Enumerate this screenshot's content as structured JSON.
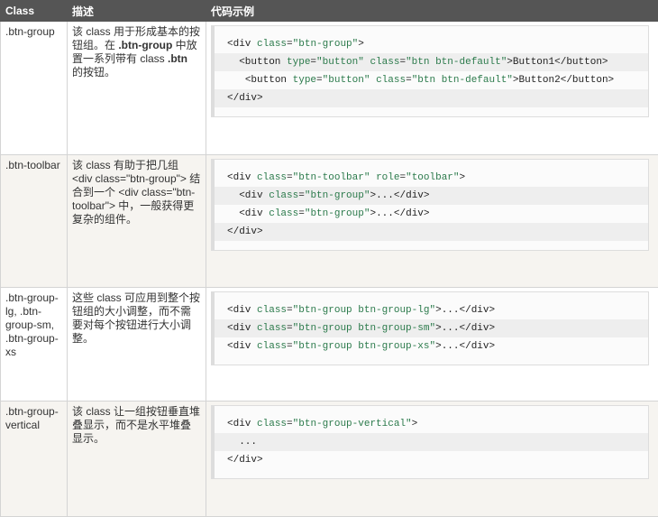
{
  "headers": {
    "class": "Class",
    "desc": "描述",
    "code": "代码示例"
  },
  "rows": [
    {
      "class": ".btn-group",
      "desc": [
        {
          "t": "该 class 用于形成基本的按钮组。在 "
        },
        {
          "t": ".btn-group",
          "b": true
        },
        {
          "t": " 中放置一系列带有 class "
        },
        {
          "t": ".btn",
          "b": true
        },
        {
          "t": " 的按钮。"
        }
      ],
      "code": [
        [
          {
            "k": "<div "
          },
          {
            "a": "class"
          },
          {
            "k": "="
          },
          {
            "s": "\"btn-group\""
          },
          {
            "k": ">"
          }
        ],
        [
          {
            "t": "  "
          },
          {
            "k": "<button "
          },
          {
            "a": "type"
          },
          {
            "k": "="
          },
          {
            "s": "\"button\""
          },
          {
            "k": " "
          },
          {
            "a": "class"
          },
          {
            "k": "="
          },
          {
            "s": "\"btn btn-default\""
          },
          {
            "k": ">"
          },
          {
            "t": "Button1"
          },
          {
            "k": "</button>"
          }
        ],
        [
          {
            "t": "   "
          },
          {
            "k": "<button "
          },
          {
            "a": "type"
          },
          {
            "k": "="
          },
          {
            "s": "\"button\""
          },
          {
            "k": " "
          },
          {
            "a": "class"
          },
          {
            "k": "="
          },
          {
            "s": "\"btn btn-default\""
          },
          {
            "k": ">"
          },
          {
            "t": "Button2"
          },
          {
            "k": "</button>"
          }
        ],
        [
          {
            "k": "</div>"
          }
        ]
      ]
    },
    {
      "class": ".btn-toolbar",
      "desc": [
        {
          "t": "该 class 有助于把几组 <div class=\"btn-group\"> 结合到一个 <div class=\"btn-toolbar\"> 中，一般获得更复杂的组件。"
        }
      ],
      "code": [
        [
          {
            "k": "<div "
          },
          {
            "a": "class"
          },
          {
            "k": "="
          },
          {
            "s": "\"btn-toolbar\""
          },
          {
            "k": " "
          },
          {
            "a": "role"
          },
          {
            "k": "="
          },
          {
            "s": "\"toolbar\""
          },
          {
            "k": ">"
          }
        ],
        [
          {
            "t": "  "
          },
          {
            "k": "<div "
          },
          {
            "a": "class"
          },
          {
            "k": "="
          },
          {
            "s": "\"btn-group\""
          },
          {
            "k": ">"
          },
          {
            "t": "..."
          },
          {
            "k": "</div>"
          }
        ],
        [
          {
            "t": "  "
          },
          {
            "k": "<div "
          },
          {
            "a": "class"
          },
          {
            "k": "="
          },
          {
            "s": "\"btn-group\""
          },
          {
            "k": ">"
          },
          {
            "t": "..."
          },
          {
            "k": "</div>"
          }
        ],
        [
          {
            "k": "</div>"
          }
        ]
      ]
    },
    {
      "class": ".btn-group-lg, .btn-group-sm, .btn-group-xs",
      "desc": [
        {
          "t": "这些 class 可应用到整个按钮组的大小调整，而不需要对每个按钮进行大小调整。"
        }
      ],
      "code": [
        [
          {
            "k": "<div "
          },
          {
            "a": "class"
          },
          {
            "k": "="
          },
          {
            "s": "\"btn-group btn-group-lg\""
          },
          {
            "k": ">"
          },
          {
            "t": "..."
          },
          {
            "k": "</div>"
          }
        ],
        [
          {
            "k": "<div "
          },
          {
            "a": "class"
          },
          {
            "k": "="
          },
          {
            "s": "\"btn-group btn-group-sm\""
          },
          {
            "k": ">"
          },
          {
            "t": "..."
          },
          {
            "k": "</div>"
          }
        ],
        [
          {
            "k": "<div "
          },
          {
            "a": "class"
          },
          {
            "k": "="
          },
          {
            "s": "\"btn-group btn-group-xs\""
          },
          {
            "k": ">"
          },
          {
            "t": "..."
          },
          {
            "k": "</div>"
          }
        ]
      ]
    },
    {
      "class": ".btn-group-vertical",
      "desc": [
        {
          "t": "该 class 让一组按钮垂直堆叠显示，而不是水平堆叠显示。"
        }
      ],
      "code": [
        [
          {
            "k": "<div "
          },
          {
            "a": "class"
          },
          {
            "k": "="
          },
          {
            "s": "\"btn-group-vertical\""
          },
          {
            "k": ">"
          }
        ],
        [
          {
            "t": "  ..."
          }
        ],
        [
          {
            "k": "</div>"
          }
        ]
      ]
    }
  ]
}
